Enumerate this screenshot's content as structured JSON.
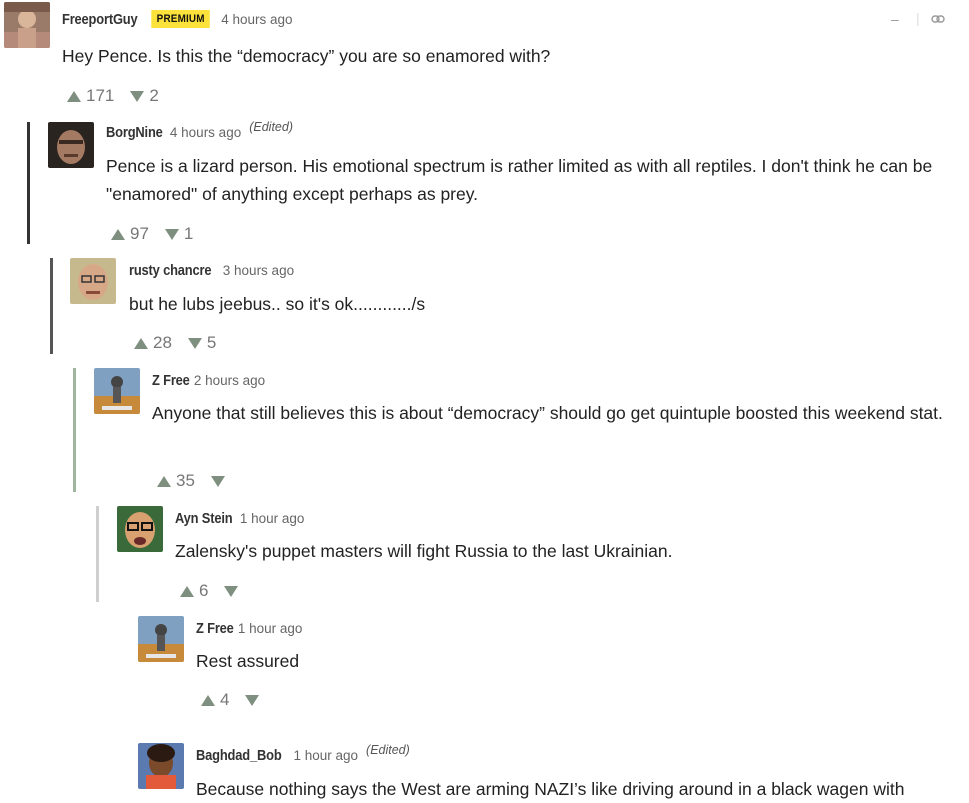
{
  "comments": [
    {
      "user": "FreeportGuy",
      "badge": "PREMIUM",
      "time": "4 hours ago",
      "edited": "",
      "body": "Hey Pence. Is this the “democracy” you are so enamored with?",
      "upvotes": "171",
      "downvotes": "2"
    },
    {
      "user": "BorgNine",
      "time": "4 hours ago",
      "edited": "(Edited)",
      "body": "Pence is a lizard person. His emotional spectrum is rather limited as with all reptiles. I don't think he can be \"enamored\" of anything except perhaps as prey.",
      "upvotes": "97",
      "downvotes": "1"
    },
    {
      "user": "rusty chancre",
      "time": "3 hours ago",
      "edited": "",
      "body": "but he lubs jeebus.. so it's ok............/s",
      "upvotes": "28",
      "downvotes": "5"
    },
    {
      "user": "Z Free",
      "time": "2 hours ago",
      "edited": "",
      "body": "Anyone that still believes this is about “democracy” should go get quintuple boosted this weekend stat.",
      "upvotes": "35",
      "downvotes": ""
    },
    {
      "user": "Ayn Stein",
      "time": "1 hour ago",
      "edited": "",
      "body": "Zalensky's puppet masters will fight Russia to the last Ukrainian.",
      "upvotes": "6",
      "downvotes": ""
    },
    {
      "user": "Z Free",
      "time": "1 hour ago",
      "edited": "",
      "body": "Rest assured",
      "upvotes": "4",
      "downvotes": ""
    },
    {
      "user": "Baghdad_Bob",
      "time": "1 hour ago",
      "edited": "(Edited)",
      "body": "Because nothing says the West are arming NAZI’s like driving around in a black wagen with",
      "upvotes": "",
      "downvotes": ""
    }
  ],
  "controls": {
    "collapse_icon": "minus-icon",
    "link_icon": "link-icon",
    "collapse_glyph": "–",
    "link_glyph": "⊝"
  },
  "colors": {
    "premium_badge": "#fde23b",
    "vote_arrow": "#7f8f7f",
    "thread_line_dark": "#333333",
    "thread_line_green": "#8fa88f",
    "thread_line_light": "#c8c8c8"
  }
}
